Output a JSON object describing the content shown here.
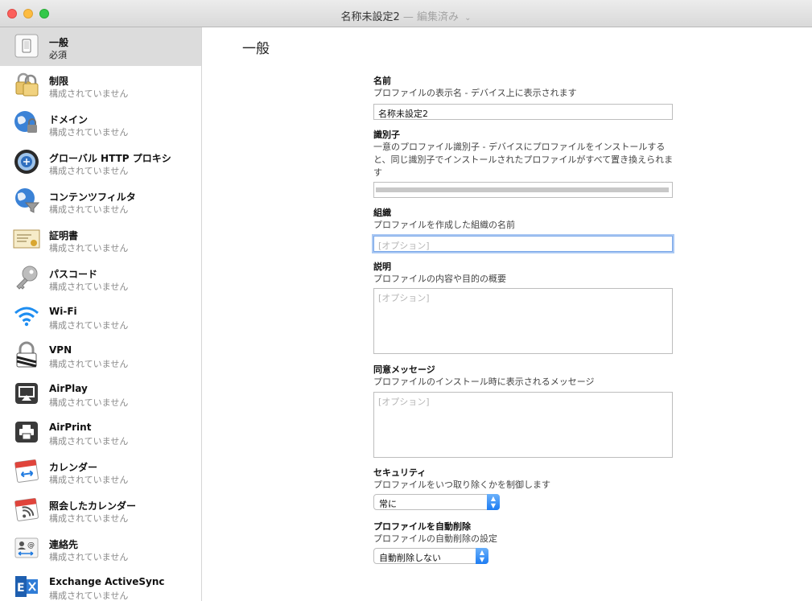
{
  "window": {
    "title": "名称未設定2",
    "separator": "—",
    "subtitle": "編集済み",
    "subtitle_chevron": "⌄"
  },
  "sidebar": {
    "items": [
      {
        "label": "一般",
        "status": "必須",
        "icon": "general-icon",
        "selected": true
      },
      {
        "label": "制限",
        "status": "構成されていません",
        "icon": "restrictions-icon"
      },
      {
        "label": "ドメイン",
        "status": "構成されていません",
        "icon": "domains-globe-icon"
      },
      {
        "label": "グローバル HTTP プロキシ",
        "status": "構成されていません",
        "icon": "global-proxy-icon"
      },
      {
        "label": "コンテンツフィルタ",
        "status": "構成されていません",
        "icon": "content-filter-icon"
      },
      {
        "label": "証明書",
        "status": "構成されていません",
        "icon": "certificate-icon"
      },
      {
        "label": "パスコード",
        "status": "構成されていません",
        "icon": "passcode-key-icon"
      },
      {
        "label": "Wi-Fi",
        "status": "構成されていません",
        "icon": "wifi-icon"
      },
      {
        "label": "VPN",
        "status": "構成されていません",
        "icon": "vpn-lock-icon"
      },
      {
        "label": "AirPlay",
        "status": "構成されていません",
        "icon": "airplay-icon"
      },
      {
        "label": "AirPrint",
        "status": "構成されていません",
        "icon": "airprint-icon"
      },
      {
        "label": "カレンダー",
        "status": "構成されていません",
        "icon": "calendar-icon"
      },
      {
        "label": "照会したカレンダー",
        "status": "構成されていません",
        "icon": "subscribed-calendar-icon"
      },
      {
        "label": "連絡先",
        "status": "構成されていません",
        "icon": "contacts-icon"
      },
      {
        "label": "Exchange ActiveSync",
        "status": "構成されていません",
        "icon": "exchange-icon"
      }
    ]
  },
  "main": {
    "title": "一般",
    "name": {
      "label": "名前",
      "description": "プロファイルの表示名 - デバイス上に表示されます",
      "value": "名称未設定2"
    },
    "identifier": {
      "label": "識別子",
      "description": "一意のプロファイル識別子 - デバイスにプロファイルをインストールすると、同じ識別子でインストールされたプロファイルがすべて置き換えられます"
    },
    "organization": {
      "label": "組織",
      "description": "プロファイルを作成した組織の名前",
      "placeholder": "[オプション]"
    },
    "description_field": {
      "label": "説明",
      "description": "プロファイルの内容や目的の概要",
      "placeholder": "[オプション]"
    },
    "consent": {
      "label": "同意メッセージ",
      "description": "プロファイルのインストール時に表示されるメッセージ",
      "placeholder": "[オプション]"
    },
    "security": {
      "label": "セキュリティ",
      "description": "プロファイルをいつ取り除くかを制御します",
      "selected": "常に"
    },
    "auto_remove": {
      "label": "プロファイルを自動削除",
      "description": "プロファイルの自動削除の設定",
      "selected": "自動削除しない"
    }
  },
  "colors": {
    "selected_row": "#dcdcdc",
    "focus_ring": "#a9c8f3",
    "accent_blue": "#1d7cf2"
  }
}
